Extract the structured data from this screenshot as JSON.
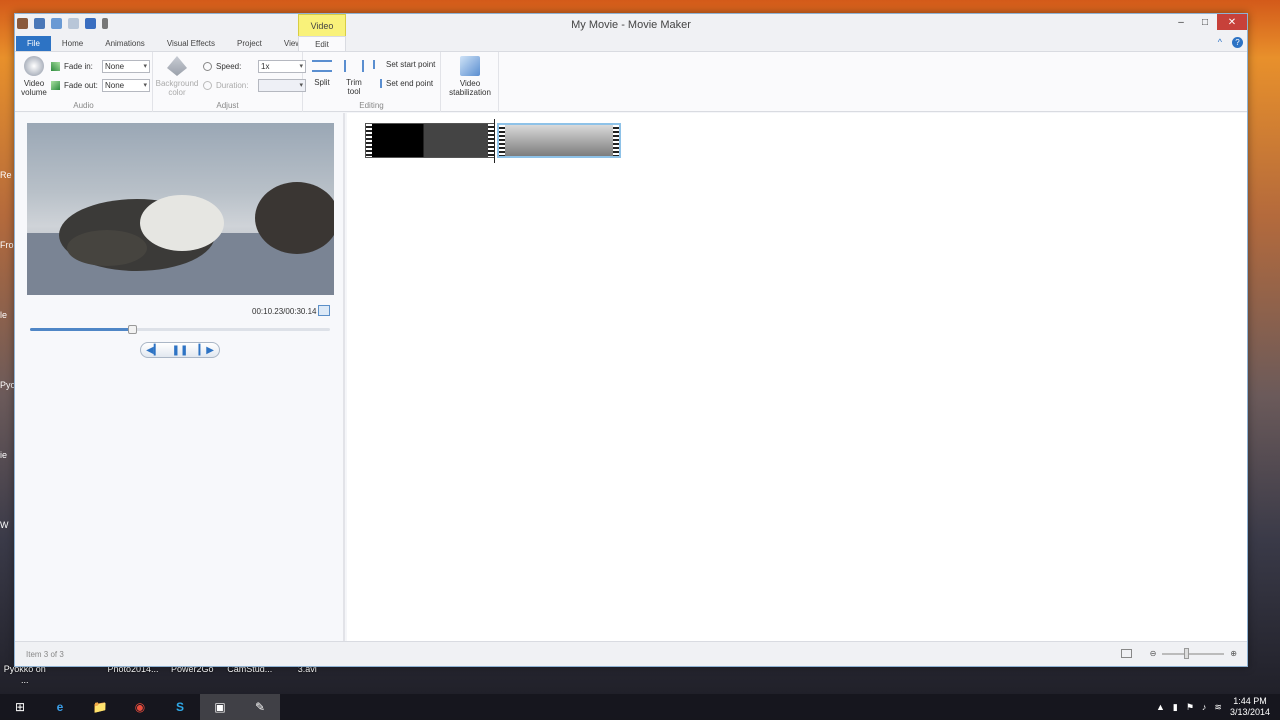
{
  "desktop": {
    "left_labels": [
      "Re",
      "Fro",
      "le",
      "Pyo",
      "ie",
      "W"
    ],
    "bottom_labels": [
      "Pyokko on ...",
      "Photo2014...",
      "Power2Go",
      "CamStud...",
      "3.avi"
    ]
  },
  "window": {
    "title": "My Movie - Movie Maker",
    "context_tab": "Video Tools",
    "controls": {
      "minimize": "–",
      "maximize": "□",
      "close": "✕"
    }
  },
  "tabs": [
    "File",
    "Home",
    "Animations",
    "Visual Effects",
    "Project",
    "View",
    "Edit"
  ],
  "ribbon_right": {
    "collapse": "^",
    "help": "?"
  },
  "ribbon": {
    "audio": {
      "label": "Audio",
      "video_volume": "Video volume",
      "fade_in_label": "Fade in:",
      "fade_in_value": "None",
      "fade_out_label": "Fade out:",
      "fade_out_value": "None"
    },
    "adjust": {
      "label": "Adjust",
      "background_color": "Background color",
      "speed_label": "Speed:",
      "speed_value": "1x",
      "duration_label": "Duration:",
      "duration_value": ""
    },
    "editing": {
      "label": "Editing",
      "split": "Split",
      "trim_tool": "Trim tool",
      "set_start": "Set start point",
      "set_end": "Set end point"
    },
    "stabilization": {
      "label": "Video stabilization"
    }
  },
  "preview": {
    "timecode": "00:10.23/00:30.14",
    "progress_fraction": 0.34
  },
  "transport": {
    "prev": "◀▎",
    "pause": "❚❚",
    "next": "▎▶"
  },
  "status": {
    "text": "Item 3 of 3"
  },
  "zoom": {
    "minus": "⊖",
    "plus": "⊕",
    "level_fraction": 0.4
  },
  "taskbar": {
    "items": [
      "⊞",
      "e",
      "📁",
      "◉",
      "S",
      "▣",
      "✎"
    ],
    "time": "1:44 PM",
    "date": "3/13/2014"
  }
}
